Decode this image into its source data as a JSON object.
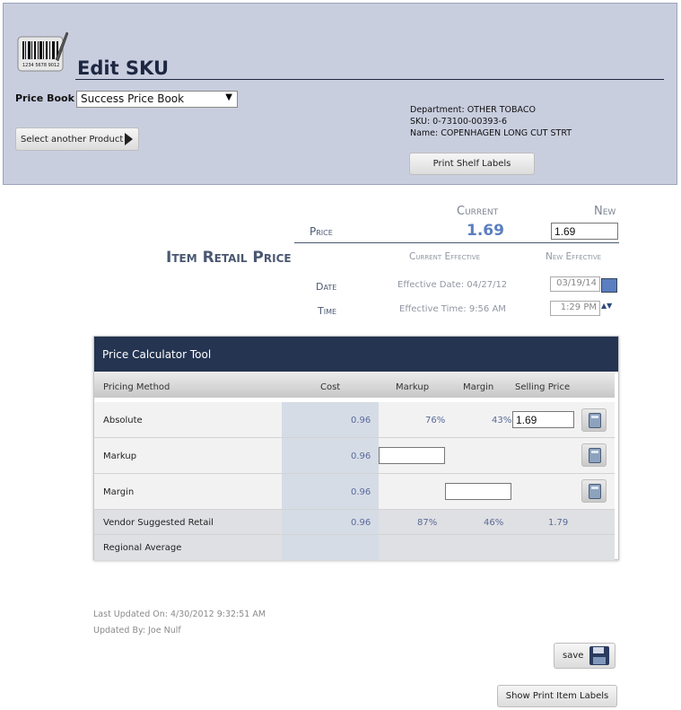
{
  "header": {
    "title": "Edit SKU",
    "price_book_label": "Price Book",
    "price_book_value": "Success Price Book",
    "select_product_label": "Select another Product",
    "department": "Department: OTHER TOBACO",
    "sku": "SKU: 0-73100-00393-6",
    "name": "Name: COPENHAGEN LONG CUT STRT",
    "print_shelf_label": "Print Shelf Labels",
    "logo_icon": "barcode-pen-icon",
    "barcode_digits": "1234 5678 9012"
  },
  "price": {
    "current_header": "Current",
    "new_header": "New",
    "price_label": "Price",
    "current_price": "1.69",
    "new_price": "1.69",
    "section_title": "Item Retail Price",
    "current_effective_header": "Current Effective",
    "new_effective_header": "New Effective",
    "date_label": "Date",
    "time_label": "Time",
    "effective_date": "Effective Date: 04/27/12",
    "effective_time": "Effective Time: 9:56 AM",
    "new_date": "03/19/14",
    "new_time": "1:29 PM"
  },
  "calculator": {
    "title": "Price Calculator Tool",
    "columns": {
      "method": "Pricing Method",
      "cost": "Cost",
      "markup": "Markup",
      "margin": "Margin",
      "selling_price": "Selling Price"
    },
    "rows": [
      {
        "label": "Absolute",
        "cost": "0.96",
        "markup": "76%",
        "margin": "43%",
        "selling_price": "1.69"
      },
      {
        "label": "Markup",
        "cost": "0.96",
        "markup": "",
        "margin": "",
        "selling_price": ""
      },
      {
        "label": "Margin",
        "cost": "0.96",
        "markup": "",
        "margin": "",
        "selling_price": ""
      },
      {
        "label": "Vendor Suggested Retail",
        "cost": "0.96",
        "markup": "87%",
        "margin": "46%",
        "selling_price": "1.79"
      },
      {
        "label": "Regional Average",
        "cost": "",
        "markup": "",
        "margin": "",
        "selling_price": ""
      }
    ]
  },
  "footer": {
    "last_updated": "Last Updated On: 4/30/2012 9:32:51 AM",
    "updated_by": "Updated By: Joe Nulf",
    "save_label": "save",
    "show_print_label": "Show Print Item Labels"
  },
  "colors": {
    "header_bg": "#c9cedf",
    "calc_header_bg": "#243451",
    "price_accent": "#5a7ec0"
  }
}
